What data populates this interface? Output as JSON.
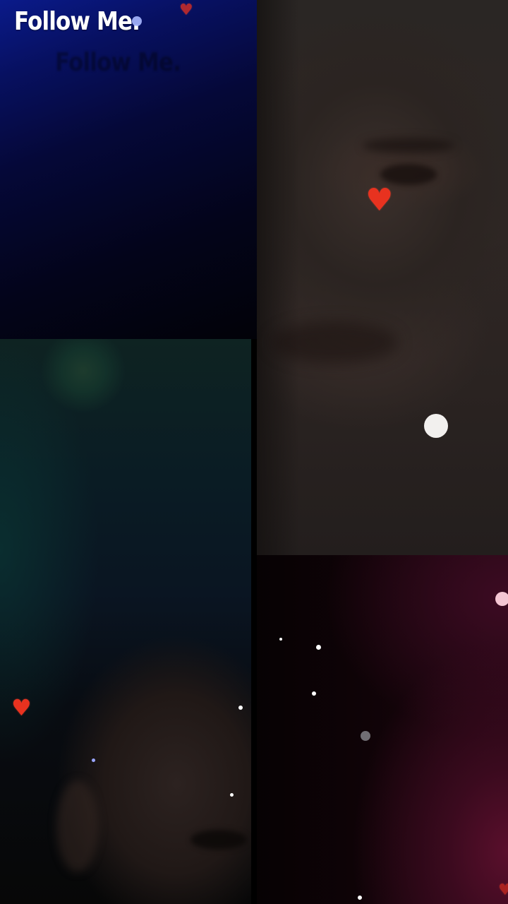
{
  "overlay": {
    "title": "Follow Me.",
    "ghost_title": "Follow Me."
  },
  "decorations": {
    "heart_glyph": "♥",
    "heart_color": "#e8321f",
    "sparkle_color": "#ffffff"
  },
  "colors": {
    "top_left_panel": "#0a1a8a",
    "bottom_right_panel": "#5a0f2c",
    "left_panel_glow": "#1d3b2d"
  }
}
